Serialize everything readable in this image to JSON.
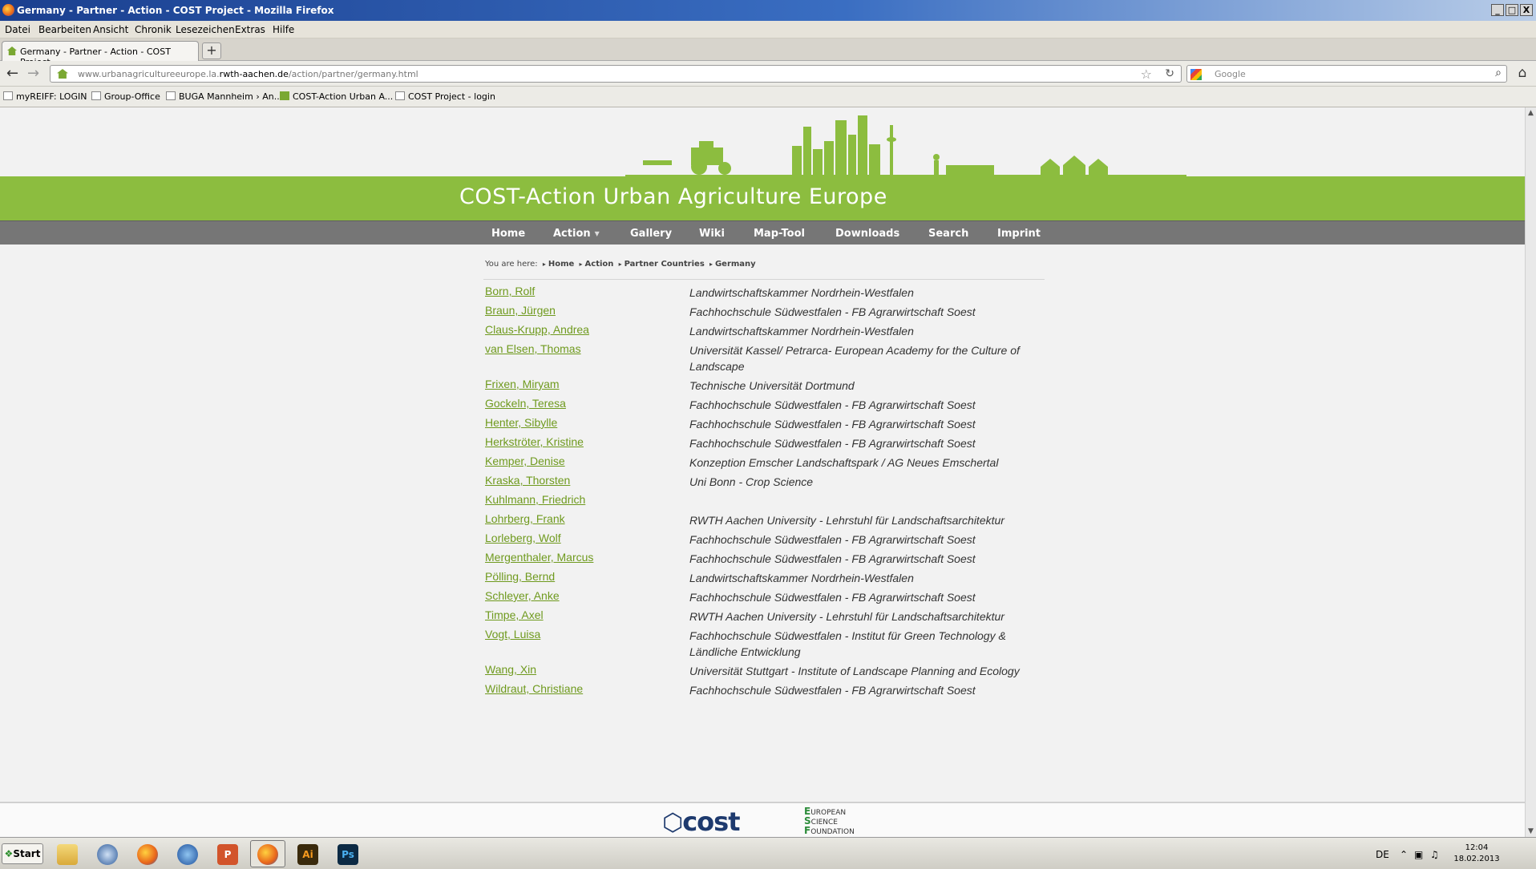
{
  "window": {
    "title": "Germany - Partner - Action - COST Project - Mozilla Firefox",
    "buttons": [
      "_",
      "□",
      "X"
    ]
  },
  "menu": [
    "Datei",
    "Bearbeiten",
    "Ansicht",
    "Chronik",
    "Lesezeichen",
    "Extras",
    "Hilfe"
  ],
  "tab": {
    "label": "Germany - Partner - Action - COST Project",
    "new_tab": "+"
  },
  "nav": {
    "url_host": "www.urbanagricultureeurope.la.",
    "url_domain": "rwth-aachen.de",
    "url_path": "/action/partner/germany.html",
    "search_placeholder": "Google"
  },
  "bookmarks": [
    "myREIFF: LOGIN",
    "Group-Office",
    "BUGA Mannheim › An...",
    "COST-Action Urban A...",
    "COST Project - login"
  ],
  "site": {
    "title": "COST-Action Urban Agriculture Europe",
    "nav": [
      "Home",
      "Action",
      "Gallery",
      "Wiki",
      "Map-Tool",
      "Downloads",
      "Search",
      "Imprint"
    ],
    "breadcrumb": {
      "prefix": "You are here:",
      "items": [
        "Home",
        "Action",
        "Partner Countries",
        "Germany"
      ]
    },
    "partners": [
      {
        "name": "Born, Rolf",
        "institution": "Landwirtschaftskammer Nordrhein-Westfalen"
      },
      {
        "name": "Braun, Jürgen",
        "institution": "Fachhochschule Südwestfalen - FB Agrarwirtschaft Soest"
      },
      {
        "name": "Claus-Krupp, Andrea",
        "institution": "Landwirtschaftskammer Nordrhein-Westfalen"
      },
      {
        "name": "van Elsen, Thomas",
        "institution": "Universität Kassel/ Petrarca- European Academy for the Culture of Landscape"
      },
      {
        "name": "Frixen, Miryam",
        "institution": "Technische Universität Dortmund"
      },
      {
        "name": "Gockeln, Teresa",
        "institution": "Fachhochschule Südwestfalen - FB Agrarwirtschaft Soest"
      },
      {
        "name": "Henter, Sibylle",
        "institution": "Fachhochschule Südwestfalen - FB Agrarwirtschaft Soest"
      },
      {
        "name": "Herkströter, Kristine",
        "institution": "Fachhochschule Südwestfalen - FB Agrarwirtschaft Soest"
      },
      {
        "name": "Kemper, Denise",
        "institution": "Konzeption Emscher Landschaftspark / AG Neues Emschertal"
      },
      {
        "name": "Kraska, Thorsten",
        "institution": "Uni Bonn - Crop Science"
      },
      {
        "name": "Kuhlmann, Friedrich",
        "institution": ""
      },
      {
        "name": "Lohrberg, Frank",
        "institution": "RWTH Aachen University - Lehrstuhl für Landschaftsarchitektur"
      },
      {
        "name": "Lorleberg, Wolf",
        "institution": "Fachhochschule Südwestfalen - FB Agrarwirtschaft Soest"
      },
      {
        "name": "Mergenthaler, Marcus",
        "institution": "Fachhochschule Südwestfalen - FB Agrarwirtschaft Soest"
      },
      {
        "name": "Pölling, Bernd",
        "institution": "Landwirtschaftskammer Nordrhein-Westfalen"
      },
      {
        "name": "Schleyer, Anke",
        "institution": "Fachhochschule Südwestfalen - FB Agrarwirtschaft Soest"
      },
      {
        "name": "Timpe, Axel",
        "institution": "RWTH Aachen University - Lehrstuhl für Landschaftsarchitektur"
      },
      {
        "name": "Vogt, Luisa",
        "institution": "Fachhochschule Südwestfalen - Institut für Green Technology & Ländliche Entwicklung"
      },
      {
        "name": "Wang, Xin",
        "institution": "Universität Stuttgart - Institute of Landscape Planning and Ecology"
      },
      {
        "name": "Wildraut, Christiane",
        "institution": "Fachhochschule Südwestfalen - FB Agrarwirtschaft Soest"
      }
    ],
    "footer": {
      "cost_logo": "cost",
      "esf_lines": [
        "UROPEAN",
        "CIENCE",
        "OUNDATION"
      ],
      "esf_initials": [
        "E",
        "S",
        "F"
      ]
    }
  },
  "taskbar": {
    "start": "Start",
    "apps": [
      "explorer-icon",
      "thunderbird-icon",
      "firefox-icon",
      "google-earth-icon",
      "powerpoint-icon",
      "firefox-icon",
      "illustrator-icon",
      "photoshop-icon"
    ],
    "app_labels": {
      "illustrator": "Ai",
      "photoshop": "Ps",
      "powerpoint": "P"
    },
    "lang": "DE",
    "time": "12:04",
    "date": "18.02.2013"
  },
  "colors": {
    "brand_green": "#8cbd3f",
    "link_green": "#6f9a1e",
    "nav_grey": "#767676"
  }
}
